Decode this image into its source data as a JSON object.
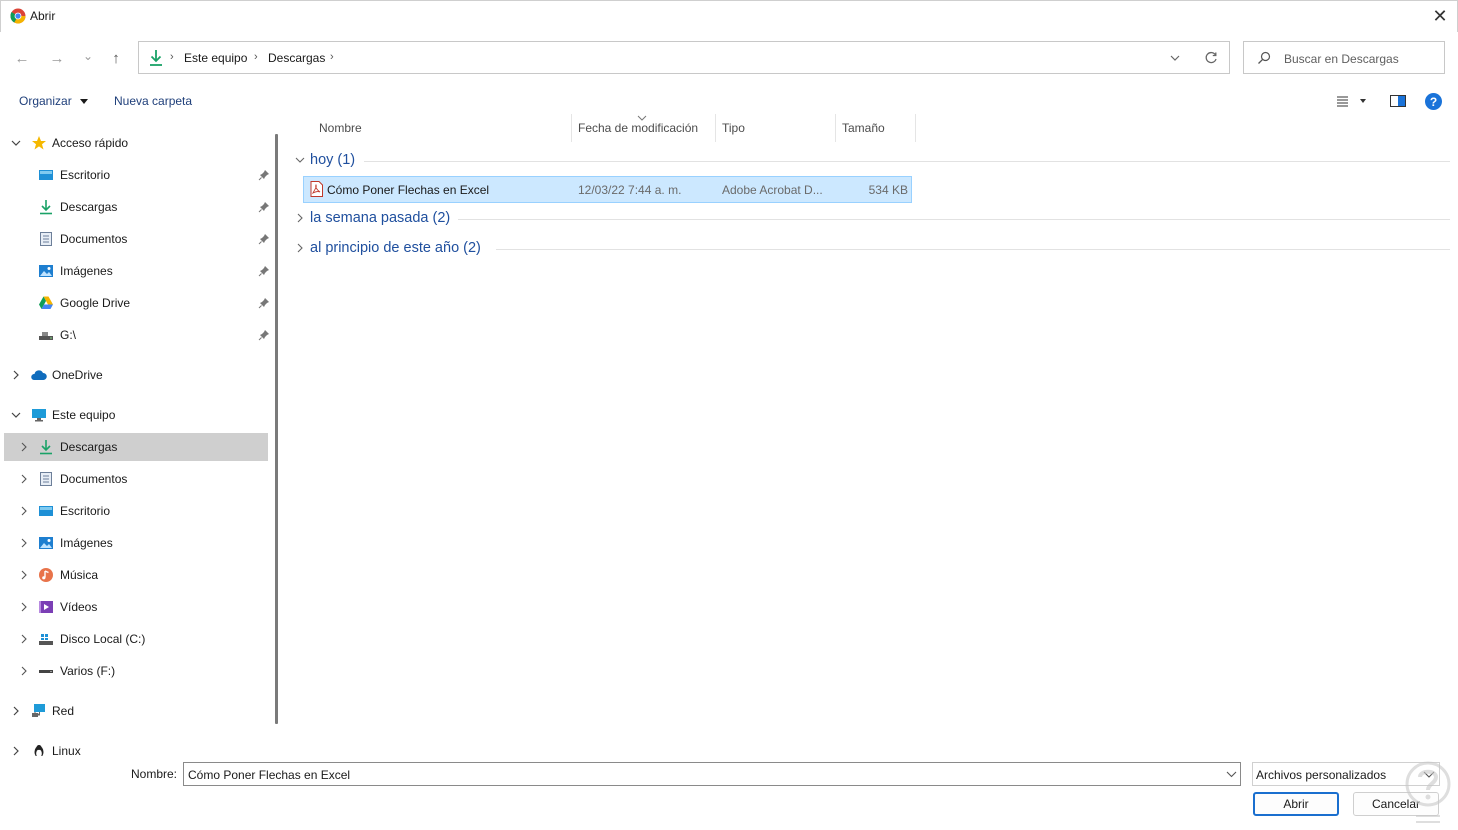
{
  "window": {
    "title": "Abrir",
    "close_glyph": "✕"
  },
  "nav_buttons": {
    "back": "←",
    "forward": "→",
    "recent": "⌄",
    "up": "↑"
  },
  "address": {
    "crumbs": [
      "Este equipo",
      "Descargas"
    ],
    "separator": "›"
  },
  "search": {
    "placeholder": "Buscar en Descargas"
  },
  "commands": {
    "organize": "Organizar",
    "new_folder": "Nueva carpeta",
    "help": "?"
  },
  "nav_pane": {
    "quick_access": "Acceso rápido",
    "quick_items": [
      "Escritorio",
      "Descargas",
      "Documentos",
      "Imágenes",
      "Google Drive",
      "G:\\"
    ],
    "onedrive": "OneDrive",
    "this_pc": "Este equipo",
    "pc_items": [
      "Descargas",
      "Documentos",
      "Escritorio",
      "Imágenes",
      "Música",
      "Vídeos",
      "Disco Local (C:)",
      "Varios (F:)"
    ],
    "network": "Red",
    "linux": "Linux"
  },
  "columns": [
    "Nombre",
    "Fecha de modificación",
    "Tipo",
    "Tamaño"
  ],
  "groups": [
    {
      "label": "hoy (1)",
      "expanded": true
    },
    {
      "label": "la semana pasada (2)",
      "expanded": false
    },
    {
      "label": "al principio de este año (2)",
      "expanded": false
    }
  ],
  "files": [
    {
      "name": "Cómo Poner Flechas en Excel",
      "modified": "12/03/22 7:44 a. m.",
      "type": "Adobe Acrobat D...",
      "size": "534 KB",
      "selected": true
    }
  ],
  "footer": {
    "name_label": "Nombre:",
    "name_value": "Cómo Poner Flechas en Excel",
    "filter_value": "Archivos personalizados",
    "open": "Abrir",
    "cancel": "Cancelar"
  },
  "colors": {
    "accent": "#1a73d9",
    "selection": "#cce8ff",
    "nav_selected": "#cfcfcf",
    "group_text": "#1f4f9e"
  }
}
